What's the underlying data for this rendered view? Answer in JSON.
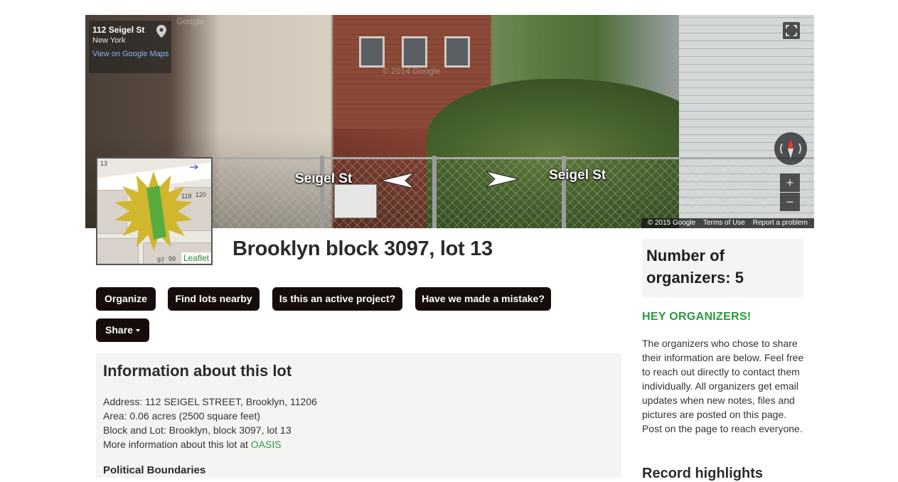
{
  "streetview": {
    "address": "112 Seigel St",
    "city": "New York",
    "maps_link": "View on Google Maps",
    "street_left": "Seigel St",
    "street_right": "Seigel St",
    "copyright": "© 2015 Google",
    "terms": "Terms of Use",
    "report": "Report a problem",
    "watermark_top": "Google",
    "watermark_mid": "© 2014 Google",
    "zoom_in": "+",
    "zoom_out": "−"
  },
  "minimap": {
    "lot_numbers": [
      "13",
      "118",
      "120",
      "97",
      "99"
    ],
    "attribution": "Leaflet",
    "colors": {
      "highlight": "#d0b72e",
      "lot": "#5aab3e"
    }
  },
  "lot": {
    "title": "Brooklyn block 3097, lot 13"
  },
  "actions": {
    "organize": "Organize",
    "find_nearby": "Find lots nearby",
    "active_project": "Is this an active project?",
    "mistake": "Have we made a mistake?",
    "share": "Share"
  },
  "info": {
    "title": "Information about this lot",
    "address": "Address: 112 SEIGEL STREET, Brooklyn, 11206",
    "area": "Area: 0.06 acres (2500 square feet)",
    "block_lot": "Block and Lot: Brooklyn, block 3097, lot 13",
    "more_prefix": "More information about this lot at",
    "more_link": "OASIS",
    "political_title": "Political Boundaries"
  },
  "sidebar": {
    "organizers_count": "Number of organizers: 5",
    "hey_title": "HEY ORGANIZERS!",
    "hey_text": "The organizers who chose to share their information are below. Feel free to reach out directly to contact them individually. All organizers get email updates when new notes, files and pictures are posted on this page. Post on the page to reach everyone.",
    "next_heading": "Record highlights"
  },
  "colors": {
    "button_bg": "#170c0c",
    "accent_green": "#2a9a3a",
    "panel_bg": "#f4f4f2"
  }
}
